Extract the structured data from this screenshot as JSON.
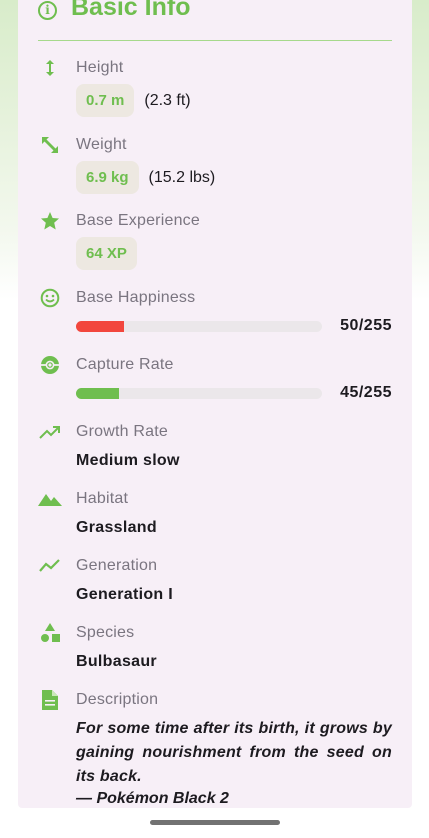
{
  "section": {
    "title": "Basic Info"
  },
  "height": {
    "label": "Height",
    "value": "0.7 m",
    "alt": "(2.3 ft)"
  },
  "weight": {
    "label": "Weight",
    "value": "6.9 kg",
    "alt": "(15.2 lbs)"
  },
  "base_experience": {
    "label": "Base Experience",
    "value": "64 XP"
  },
  "base_happiness": {
    "label": "Base Happiness",
    "value_text": "50/255",
    "fraction": 0.196,
    "color": "#f2463d"
  },
  "capture_rate": {
    "label": "Capture Rate",
    "value_text": "45/255",
    "fraction": 0.176,
    "color": "#6fbe4f"
  },
  "growth_rate": {
    "label": "Growth Rate",
    "value": "Medium slow"
  },
  "habitat": {
    "label": "Habitat",
    "value": "Grassland"
  },
  "generation": {
    "label": "Generation",
    "value": "Generation I"
  },
  "species": {
    "label": "Species",
    "value": "Bulbasaur"
  },
  "description": {
    "label": "Description",
    "text": "For some time after its birth, it grows by gaining nourishment from the seed on its back.",
    "source": "— Pokémon Black 2"
  },
  "icons": {
    "section": "info-icon",
    "height": "vertical-arrows-icon",
    "weight": "diagonal-arrows-icon",
    "base_experience": "star-icon",
    "base_happiness": "smiley-icon",
    "capture_rate": "pokeball-icon",
    "growth_rate": "trending-up-icon",
    "habitat": "mountain-icon",
    "generation": "timeline-icon",
    "species": "shapes-icon",
    "description": "document-icon"
  },
  "colors": {
    "accent": "#6fbe4f",
    "chip_bg": "#ede8e1",
    "card_bg": "#f7eff7"
  }
}
